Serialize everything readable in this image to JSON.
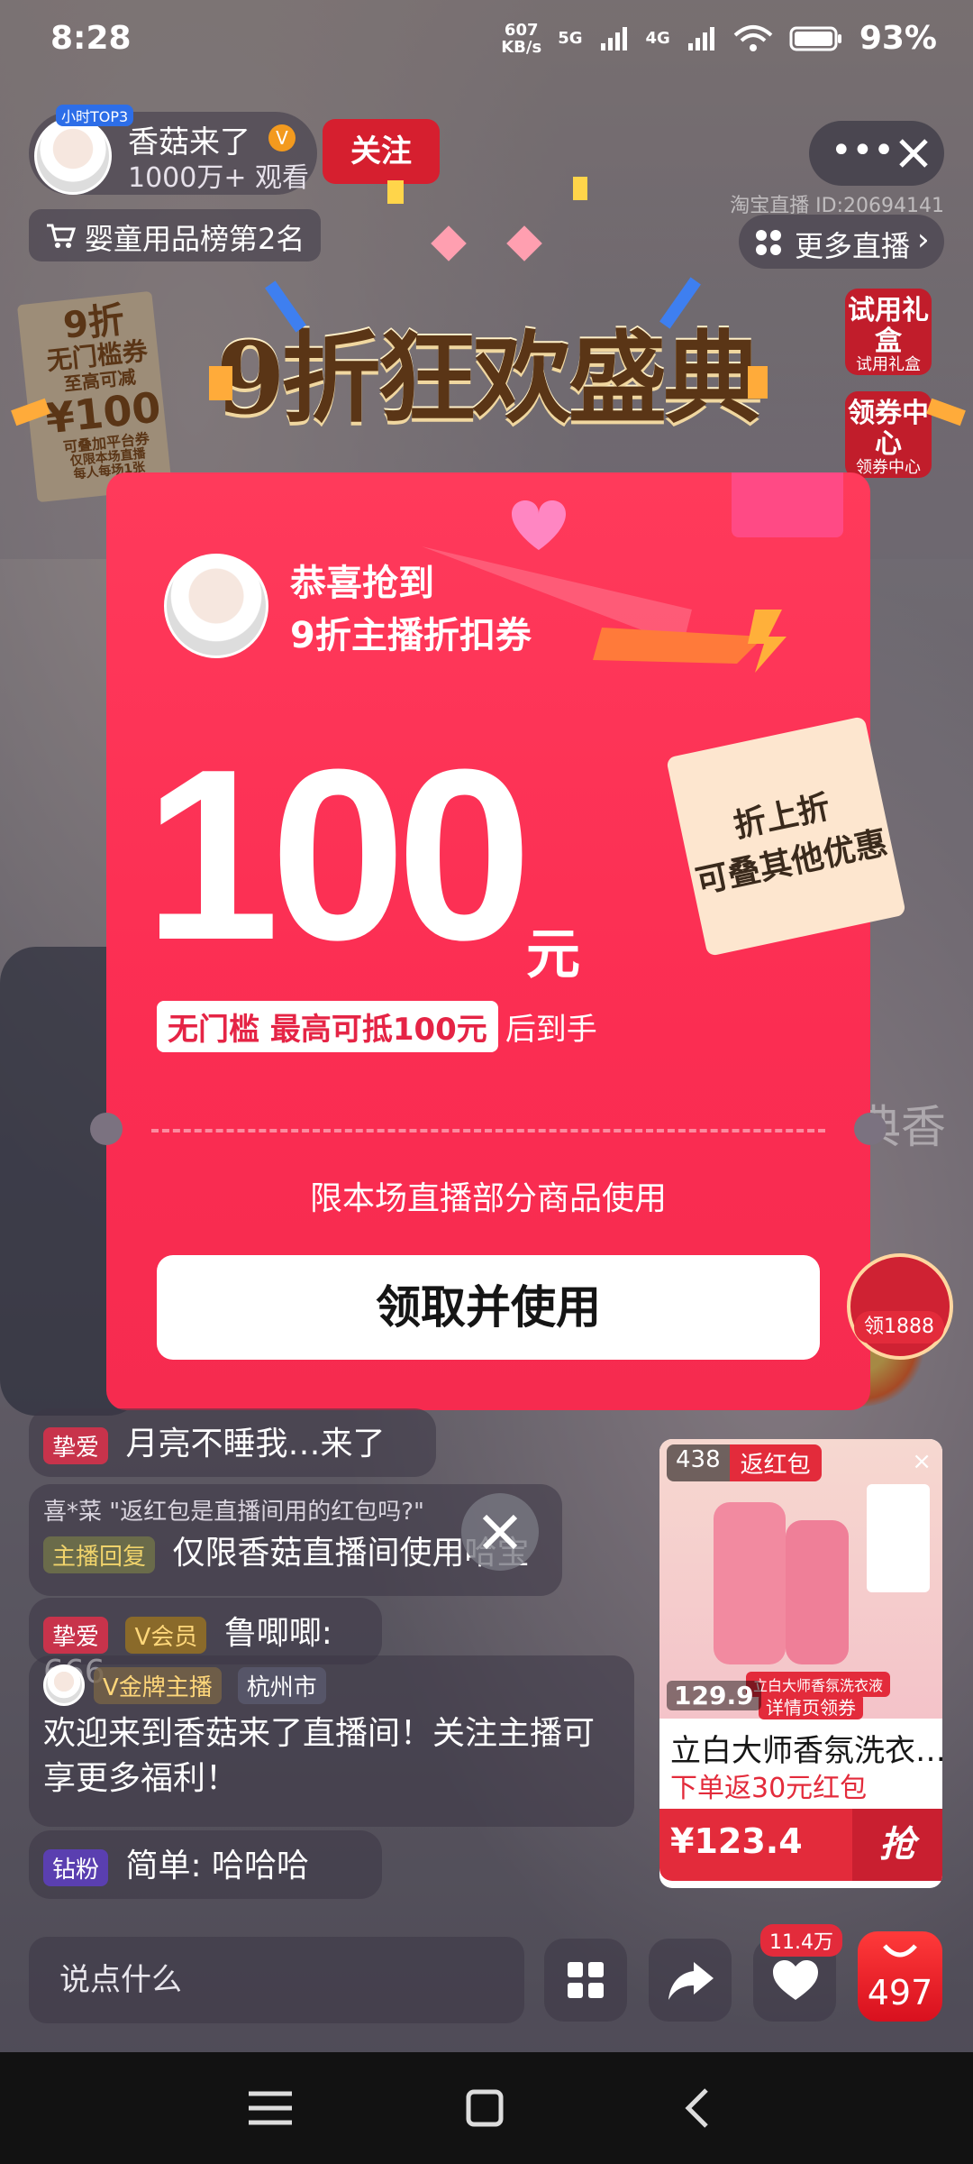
{
  "status_bar": {
    "time": "8:28",
    "net_speed_value": "607",
    "net_speed_unit": "KB/s",
    "net_5g": "5G",
    "net_4g": "4G",
    "battery": "93%"
  },
  "host": {
    "name": "香菇来了",
    "viewers": "1000万+ 观看",
    "follow_label": "关注",
    "ranking_chip": "婴童用品榜第2名",
    "room_id": "淘宝直播 ID:20694141",
    "more_live_label": "更多直播",
    "top_badge": "小时TOP3"
  },
  "right_rail": {
    "trial_gift_title": "试用礼盒",
    "trial_gift_caption": "试用礼盒",
    "coupon_center_title": "领券中心",
    "coupon_center_caption": "领券中心"
  },
  "banner": {
    "title": "9折狂欢盛典",
    "left_ticket_line1": "9折",
    "left_ticket_line2": "无门槛券",
    "left_ticket_line3": "至高可减",
    "left_ticket_amount": "¥100",
    "left_ticket_line4": "可叠加平台券",
    "left_ticket_line5": "仅限本场直播",
    "left_ticket_line6": "每人每场1张",
    "background_text": "全典香"
  },
  "coupon_popup": {
    "congrats": "恭喜抢到",
    "coupon_name": "9折主播折扣券",
    "amount": "100",
    "currency": "元",
    "condition_tag": "无门槛 最高可抵100元",
    "condition_suffix": "后到手",
    "stack_note_line1": "折上折",
    "stack_note_line2": "可叠其他优惠",
    "scope": "限本场直播部分商品使用",
    "claim_button": "领取并使用"
  },
  "red_packet": {
    "label": "领1888"
  },
  "chat": [
    {
      "tag": "挚爱",
      "text": "月亮不睡我…来了"
    },
    {
      "quote": "喜*菜 \"返红包是直播间用的红包吗?\"",
      "tag": "主播回复",
      "text": "仅限香菇直播间使用哈宝"
    },
    {
      "tag": "挚爱",
      "tag2": "V会员",
      "text": "鲁唧唧: 666"
    },
    {
      "tag": "V金牌主播",
      "tag2": "杭州市",
      "text": "欢迎来到香菇来了直播间！关注主播可享更多福利！"
    },
    {
      "tag": "钻粉",
      "text": "简单: 哈哈哈"
    }
  ],
  "product_card": {
    "count": "438",
    "badge": "返红包",
    "brand_chip": "立白大师香氛洗衣液",
    "sub_chip": "详情页领券",
    "new_user_price": "129.9",
    "title": "立白大师香氛洗衣…",
    "promo": "下单返30元红包",
    "price": "¥123.4",
    "buy_label": "抢"
  },
  "bottom_bar": {
    "comment_placeholder": "说点什么",
    "likes": "11.4万",
    "cart_count": "497"
  },
  "colors": {
    "coupon_red": "#fb2d52",
    "follow_red": "#d61f2f",
    "tag_red": "#c82a3a",
    "product_red": "#e32b3b"
  }
}
